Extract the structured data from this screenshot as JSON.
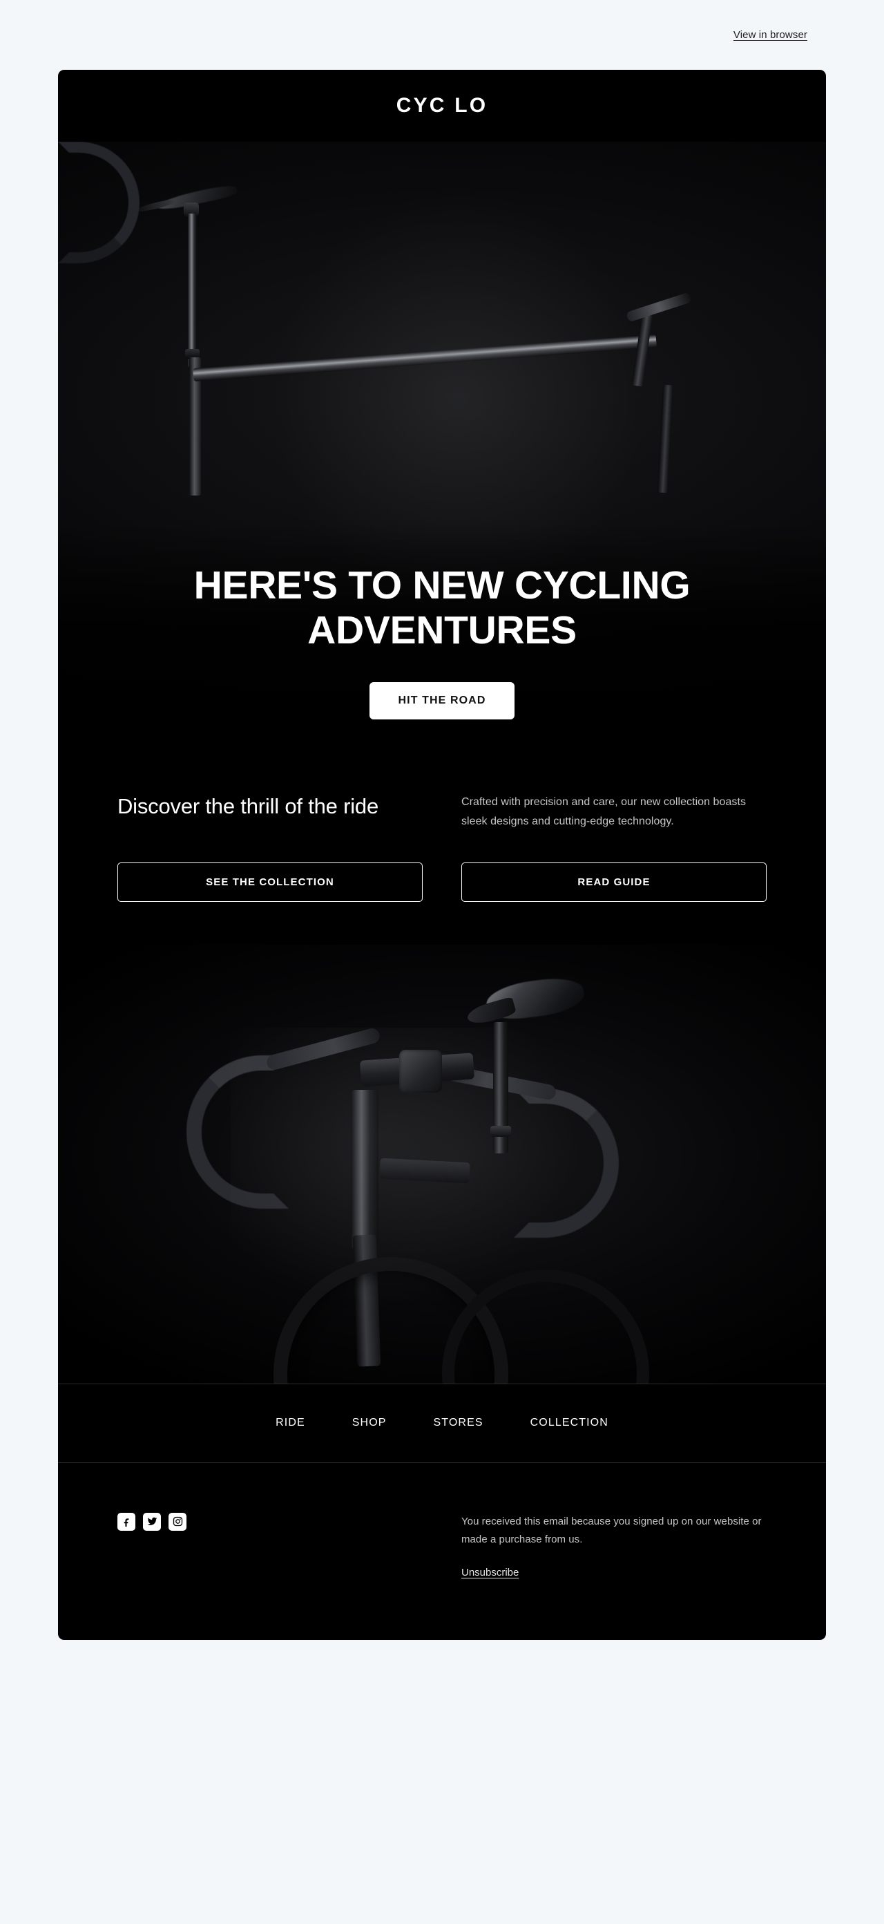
{
  "preheader": {
    "view_in_browser": "View in browser"
  },
  "brand": {
    "logo": "CYC LO"
  },
  "hero": {
    "title": "HERE'S TO NEW CYCLING ADVENTURES",
    "cta_label": "HIT THE ROAD",
    "image_alt": "dark road bicycle saddle seatpost top tube and drop handlebar"
  },
  "intro": {
    "heading": "Discover the thrill of the ride",
    "body": "Crafted with precision and care, our new collection boasts sleek designs and cutting-edge technology.",
    "primary_cta": "SEE THE COLLECTION",
    "secondary_cta": "READ GUIDE"
  },
  "product": {
    "image_alt": "front view of a black road bike with drop handlebars and saddle"
  },
  "nav": {
    "items": [
      {
        "label": "RIDE"
      },
      {
        "label": "SHOP"
      },
      {
        "label": "STORES"
      },
      {
        "label": "COLLECTION"
      }
    ]
  },
  "footer": {
    "social": [
      {
        "name": "facebook",
        "label": "Facebook"
      },
      {
        "name": "twitter",
        "label": "Twitter"
      },
      {
        "name": "instagram",
        "label": "Instagram"
      }
    ],
    "disclaimer": "You received this email because you signed up on our website or made a purchase from us.",
    "unsubscribe": "Unsubscribe"
  },
  "colors": {
    "page_background": "#f3f7fa",
    "card_background": "#000000",
    "text_primary": "#ffffff",
    "text_muted": "#c6c6c8",
    "divider": "#2b2b2b",
    "button_solid_bg": "#ffffff",
    "button_solid_text": "#111111"
  }
}
